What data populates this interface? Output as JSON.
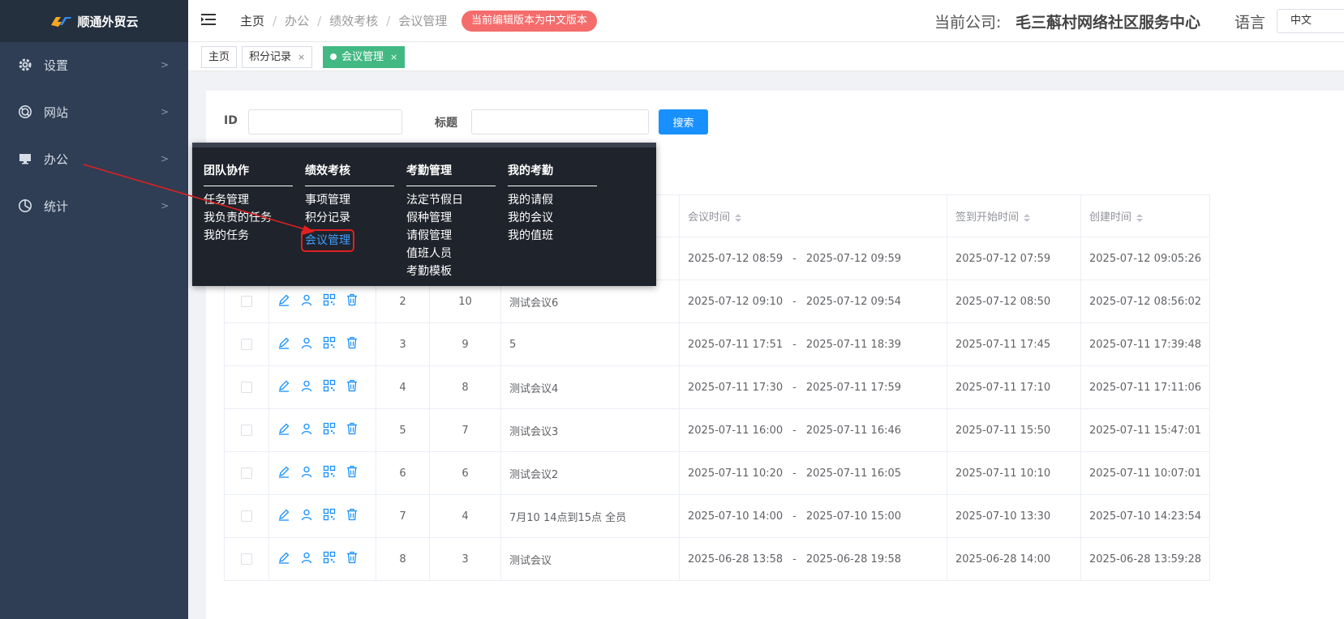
{
  "app": {
    "logo_text": "顺通外贸云"
  },
  "sidebar": {
    "items": [
      {
        "label": "设置",
        "icon": "gear-icon"
      },
      {
        "label": "网站",
        "icon": "globe-icon"
      },
      {
        "label": "办公",
        "icon": "monitor-icon"
      },
      {
        "label": "统计",
        "icon": "pie-chart-icon"
      }
    ]
  },
  "header": {
    "breadcrumbs": [
      "主页",
      "办公",
      "绩效考核",
      "会议管理"
    ],
    "badge": "当前编辑版本为中文版本",
    "company_label": "当前公司:",
    "company_name": "毛三蔛村网络社区服务中心",
    "lang_label": "语言",
    "lang_value": "中文"
  },
  "tabs": [
    {
      "label": "主页"
    },
    {
      "label": "积分记录",
      "close": "×"
    },
    {
      "label": "会议管理",
      "close": "×",
      "active": true
    }
  ],
  "search": {
    "id_label": "ID",
    "title_label": "标题",
    "button": "搜索"
  },
  "mega_menu": {
    "columns": [
      {
        "title": "团队协作",
        "items": [
          "任务管理",
          "我负责的任务",
          "我的任务"
        ]
      },
      {
        "title": "绩效考核",
        "items": [
          "事项管理",
          "积分记录",
          "会议管理"
        ],
        "highlighted": "会议管理"
      },
      {
        "title": "考勤管理",
        "items": [
          "法定节假日",
          "假种管理",
          "请假管理",
          "值班人员",
          "考勤模板"
        ]
      },
      {
        "title": "我的考勤",
        "items": [
          "我的请假",
          "我的会议",
          "我的值班"
        ]
      }
    ]
  },
  "table": {
    "headers": {
      "meeting_time": "会议时间",
      "signin_start": "签到开始时间",
      "created": "创建时间"
    },
    "time_sep": "-",
    "rows": [
      {
        "no": "",
        "id": "",
        "title": "",
        "start": "2025-07-12 08:59",
        "end": "2025-07-12 09:59",
        "signin": "2025-07-12 07:59",
        "created": "2025-07-12 09:05:26"
      },
      {
        "no": "2",
        "id": "10",
        "title": "测试会议6",
        "start": "2025-07-12 09:10",
        "end": "2025-07-12 09:54",
        "signin": "2025-07-12 08:50",
        "created": "2025-07-12 08:56:02"
      },
      {
        "no": "3",
        "id": "9",
        "title": "5",
        "start": "2025-07-11 17:51",
        "end": "2025-07-11 18:39",
        "signin": "2025-07-11 17:45",
        "created": "2025-07-11 17:39:48"
      },
      {
        "no": "4",
        "id": "8",
        "title": "测试会议4",
        "start": "2025-07-11 17:30",
        "end": "2025-07-11 17:59",
        "signin": "2025-07-11 17:10",
        "created": "2025-07-11 17:11:06"
      },
      {
        "no": "5",
        "id": "7",
        "title": "测试会议3",
        "start": "2025-07-11 16:00",
        "end": "2025-07-11 16:46",
        "signin": "2025-07-11 15:50",
        "created": "2025-07-11 15:47:01"
      },
      {
        "no": "6",
        "id": "6",
        "title": "测试会议2",
        "start": "2025-07-11 10:20",
        "end": "2025-07-11 16:05",
        "signin": "2025-07-11 10:10",
        "created": "2025-07-11 10:07:01"
      },
      {
        "no": "7",
        "id": "4",
        "title": "7月10 14点到15点 全员",
        "start": "2025-07-10 14:00",
        "end": "2025-07-10 15:00",
        "signin": "2025-07-10 13:30",
        "created": "2025-07-10 14:23:54"
      },
      {
        "no": "8",
        "id": "3",
        "title": "测试会议",
        "start": "2025-06-28 13:58",
        "end": "2025-06-28 19:58",
        "signin": "2025-06-28 14:00",
        "created": "2025-06-28 13:59:28"
      }
    ]
  }
}
